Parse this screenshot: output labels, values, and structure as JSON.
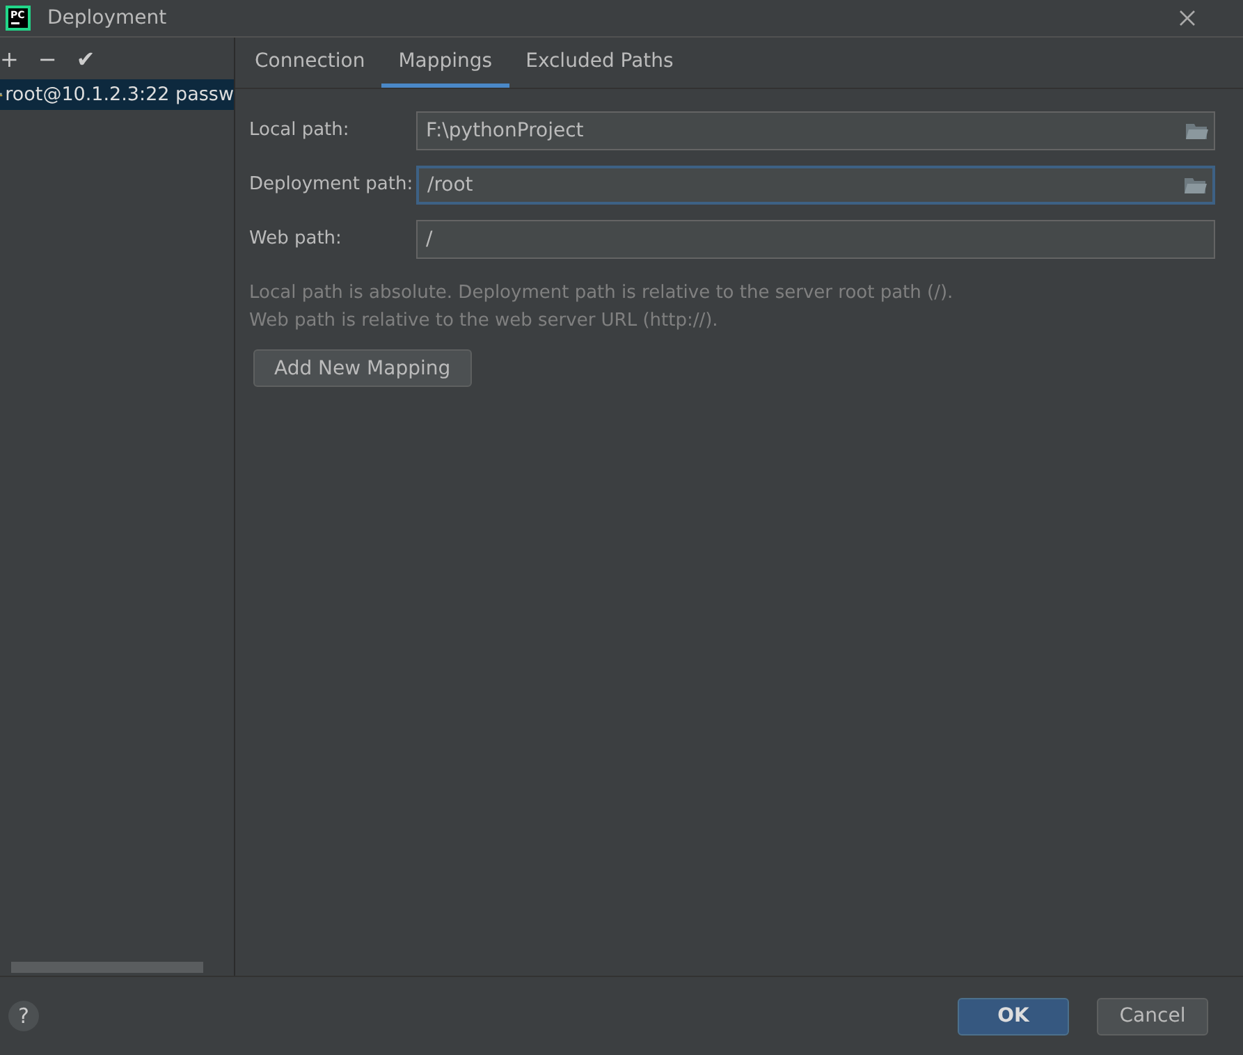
{
  "window": {
    "title": "Deployment",
    "logo_text": "PC"
  },
  "toolbar": {
    "add": "+",
    "remove": "−",
    "apply": "✔"
  },
  "servers": [
    {
      "label": "root@10.1.2.3:22 passw",
      "selected": true
    }
  ],
  "tabs": [
    {
      "label": "Connection",
      "selected": false
    },
    {
      "label": "Mappings",
      "selected": true
    },
    {
      "label": "Excluded Paths",
      "selected": false
    }
  ],
  "fields": [
    {
      "label": "Local path:",
      "value": "F:\\pythonProject",
      "browse": true,
      "focused": false
    },
    {
      "label": "Deployment path:",
      "value": "/root",
      "browse": true,
      "focused": true
    },
    {
      "label": "Web path:",
      "value": "/",
      "browse": false,
      "focused": false
    }
  ],
  "hint_lines": [
    "Local path is absolute. Deployment path is relative to the server root path (/).",
    "Web path is relative to the web server URL (http://)."
  ],
  "add_button": "Add New Mapping",
  "help": "?",
  "buttons": [
    {
      "label": "OK",
      "primary": true
    },
    {
      "label": "Cancel",
      "primary": false
    }
  ]
}
